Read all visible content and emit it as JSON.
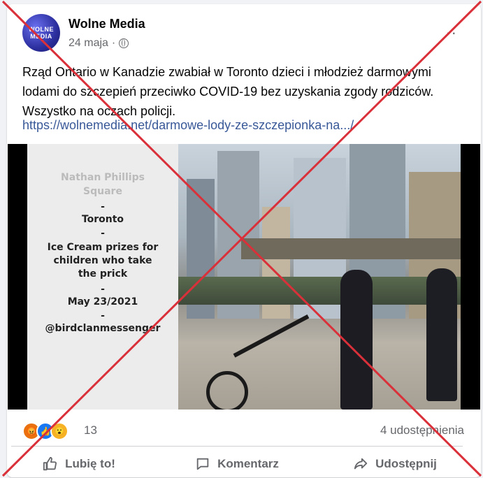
{
  "post": {
    "page_name": "Wolne Media",
    "avatar_text": "WOLNE MEDIA",
    "date": "24 maja",
    "separator": "·",
    "more_label": "··",
    "text": "Rząd Ontario w Kanadzie zwabiał w Toronto dzieci i młodzież darmowymi lodami do szczepień przeciwko COVID-19 bez uzyskania zgody rodziców. Wszystko na oczach policji.",
    "link": "https://wolnemedia.net/darmowe-lody-ze-szczepionka-na.../"
  },
  "image": {
    "panel_lines": [
      "Nathan Phillips",
      "Square",
      "-",
      "Toronto",
      "-",
      "Ice Cream prizes for",
      "children who take",
      "the prick",
      "-",
      "May 23/2021",
      "-",
      "@birdclanmessenger"
    ]
  },
  "stats": {
    "reactions": [
      "angry-icon",
      "like-icon",
      "wow-icon"
    ],
    "reaction_count": "13",
    "shares": "4 udostępnienia"
  },
  "actions": {
    "like": "Lubię to!",
    "comment": "Komentarz",
    "share": "Udostępnij"
  },
  "colors": {
    "link": "#385898",
    "cross": "#d9303a",
    "muted": "#65676b"
  }
}
